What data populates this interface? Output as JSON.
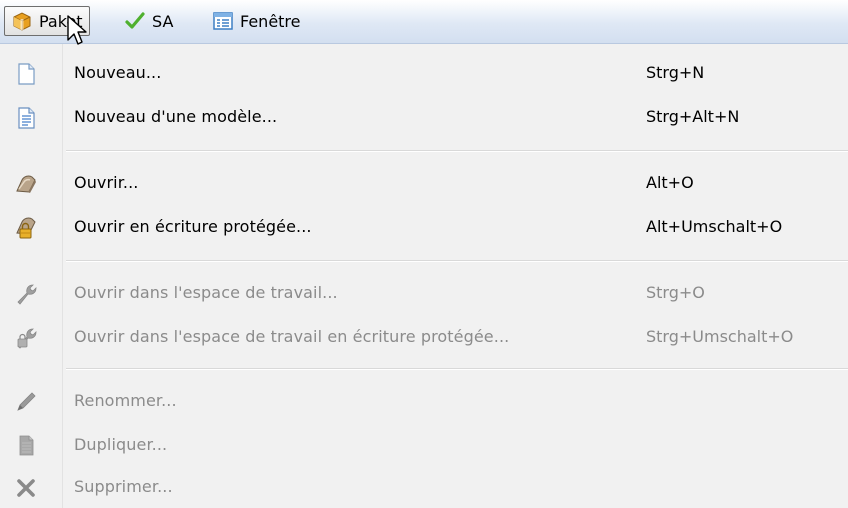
{
  "menubar": {
    "items": [
      {
        "label": "Paket",
        "icon": "package-icon",
        "active": true
      },
      {
        "label": "SA",
        "icon": "checkmark-icon"
      },
      {
        "label": "Fenêtre",
        "icon": "window-icon"
      }
    ]
  },
  "menu": {
    "items": [
      {
        "label": "Nouveau...",
        "shortcut": "Strg+N",
        "icon": "new-document-icon",
        "enabled": true
      },
      {
        "label": "Nouveau d'une modèle...",
        "shortcut": "Strg+Alt+N",
        "icon": "template-document-icon",
        "enabled": true
      },
      {
        "label": "Ouvrir...",
        "shortcut": "Alt+O",
        "icon": "open-icon",
        "enabled": true
      },
      {
        "label": "Ouvrir en écriture protégée...",
        "shortcut": "Alt+Umschalt+O",
        "icon": "open-locked-icon",
        "enabled": true
      },
      {
        "label": "Ouvrir dans l'espace de travail...",
        "shortcut": "Strg+O",
        "icon": "wrench-icon",
        "enabled": false
      },
      {
        "label": "Ouvrir dans l'espace de travail en écriture protégée...",
        "shortcut": "Strg+Umschalt+O",
        "icon": "wrench-locked-icon",
        "enabled": false
      },
      {
        "label": "Renommer...",
        "shortcut": "",
        "icon": "pencil-icon",
        "enabled": false
      },
      {
        "label": "Dupliquer...",
        "shortcut": "",
        "icon": "duplicate-icon",
        "enabled": false
      },
      {
        "label": "Supprimer...",
        "shortcut": "",
        "icon": "delete-icon",
        "enabled": false
      }
    ]
  },
  "colors": {
    "menubar_top": "#ffffff",
    "menubar_bottom": "#d3dff0",
    "menu_bg": "#f1f1f1",
    "disabled_text": "#8b8b8b",
    "check_green": "#4fb02f"
  }
}
